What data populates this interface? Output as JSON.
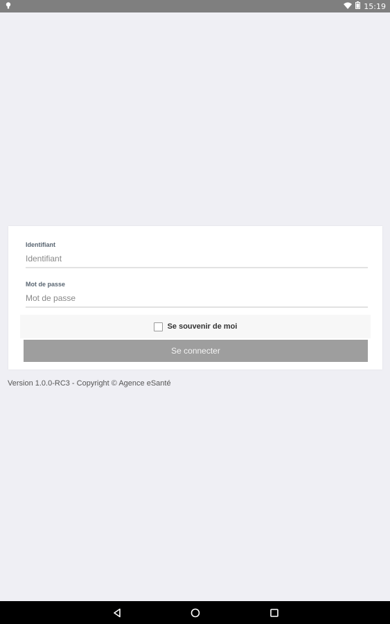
{
  "status_bar": {
    "time": "15:19",
    "icons": [
      "notification-bulb-icon",
      "wifi-icon",
      "battery-icon"
    ]
  },
  "login_form": {
    "username": {
      "label": "Identifiant",
      "placeholder": "Identifiant",
      "value": ""
    },
    "password": {
      "label": "Mot de passe",
      "placeholder": "Mot de passe",
      "value": ""
    },
    "remember_me": {
      "label": "Se souvenir de moi",
      "checked": false
    },
    "submit_label": "Se connecter"
  },
  "footer": {
    "version_text": "Version 1.0.0-RC3 - Copyright © Agence eSanté"
  },
  "nav_bar": {
    "icons": [
      "back-icon",
      "home-icon",
      "recents-icon"
    ]
  },
  "colors": {
    "background": "#efeff4",
    "status_bar": "#7f7f7f",
    "button": "#9e9e9e",
    "nav_bar": "#000000"
  }
}
